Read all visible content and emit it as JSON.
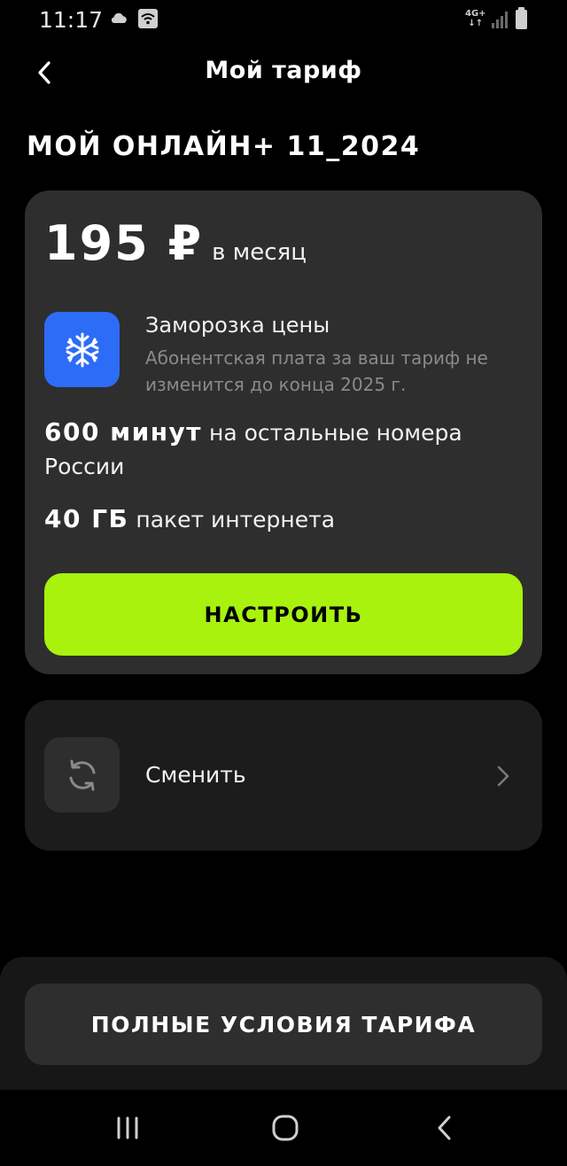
{
  "status_bar": {
    "time": "11:17",
    "network_type": "4G+",
    "icons": [
      "cloud-icon",
      "wifi-icon",
      "signal-icon",
      "battery-icon"
    ]
  },
  "header": {
    "title": "Мой тариф",
    "back_icon": "chevron-left-icon"
  },
  "tariff": {
    "name": "МОЙ ОНЛАЙН+ 11_2024",
    "price": "195 ₽",
    "period": "в месяц",
    "freeze": {
      "icon": "snowflake-icon",
      "title": "Заморозка цены",
      "description": "Абонентская плата за ваш тариф не изменится до конца 2025 г."
    },
    "minutes": {
      "value": "600 минут",
      "text": "на остальные номера России"
    },
    "internet": {
      "value": "40 ГБ",
      "text": "пакет интернета"
    },
    "configure_label": "НАСТРОИТЬ"
  },
  "change": {
    "icon": "refresh-icon",
    "label": "Сменить",
    "chevron_icon": "chevron-right-icon"
  },
  "full_terms_label": "ПОЛНЫЕ УСЛОВИЯ ТАРИФА",
  "colors": {
    "background": "#000000",
    "card": "#2e2e2e",
    "accent": "#a8f20e",
    "freeze_icon_bg": "#2d6cf6",
    "muted_text": "#8a8a8a"
  }
}
